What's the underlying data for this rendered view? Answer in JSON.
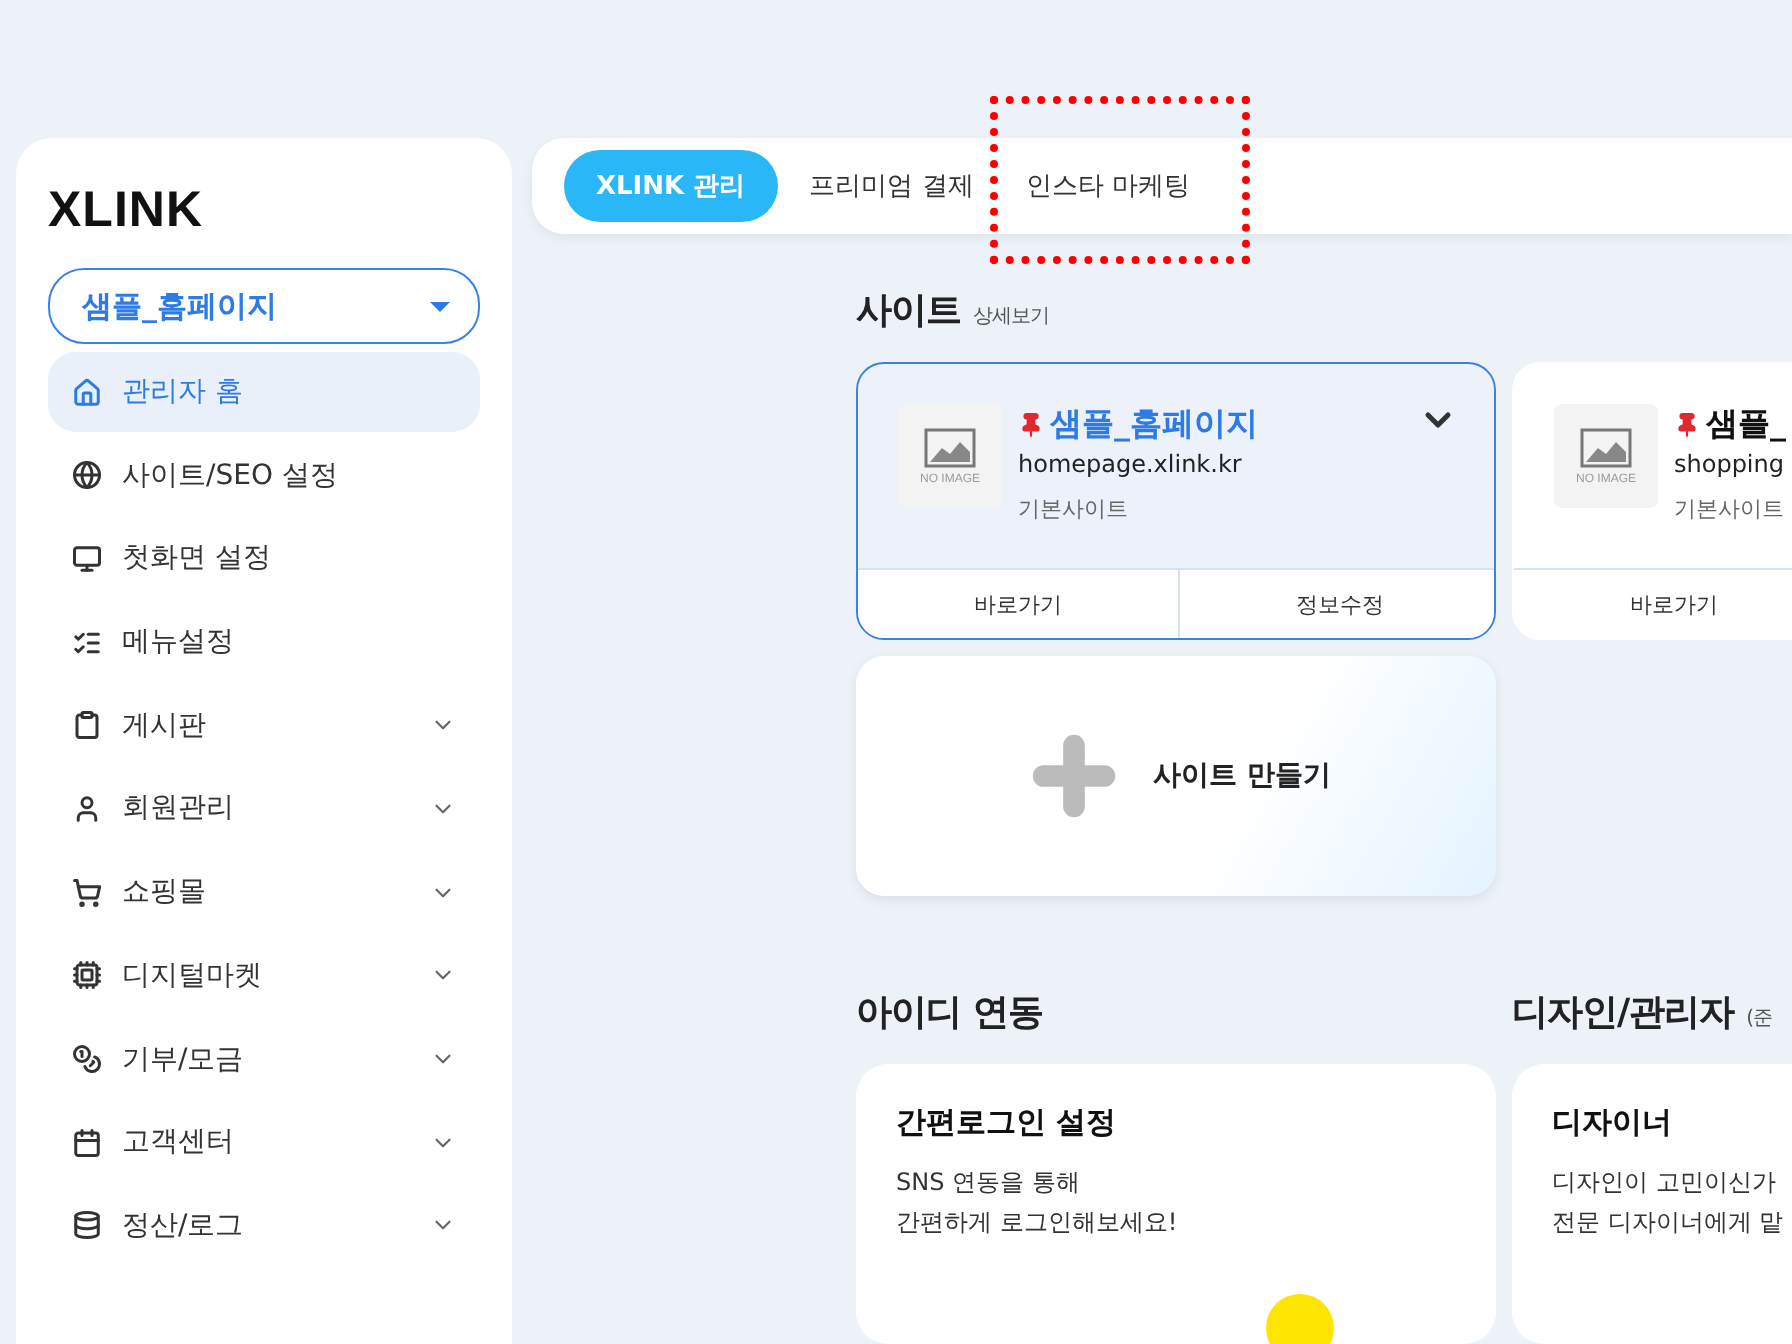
{
  "sidebar": {
    "logo": "XLINK",
    "site_select": {
      "value": "샘플_홈페이지"
    },
    "items": [
      {
        "label": "관리자 홈",
        "selected": true,
        "has_submenu": false
      },
      {
        "label": "사이트/SEO 설정",
        "selected": false,
        "has_submenu": false
      },
      {
        "label": "첫화면 설정",
        "selected": false,
        "has_submenu": false
      },
      {
        "label": "메뉴설정",
        "selected": false,
        "has_submenu": false
      },
      {
        "label": "게시판",
        "selected": false,
        "has_submenu": true
      },
      {
        "label": "회원관리",
        "selected": false,
        "has_submenu": true
      },
      {
        "label": "쇼핑몰",
        "selected": false,
        "has_submenu": true
      },
      {
        "label": "디지털마켓",
        "selected": false,
        "has_submenu": true
      },
      {
        "label": "기부/모금",
        "selected": false,
        "has_submenu": true
      },
      {
        "label": "고객센터",
        "selected": false,
        "has_submenu": true
      },
      {
        "label": "정산/로그",
        "selected": false,
        "has_submenu": true
      }
    ]
  },
  "top_tabs": [
    {
      "label": "XLINK 관리",
      "selected": true,
      "highlighted": false
    },
    {
      "label": "프리미엄 결제",
      "selected": false,
      "highlighted": false
    },
    {
      "label": "인스타 마케팅",
      "selected": false,
      "highlighted": true
    }
  ],
  "sites_section": {
    "title": "사이트",
    "link": "상세보기",
    "sites": [
      {
        "image_label": "NO IMAGE",
        "name": "샘플_홈페이지",
        "domain": "homepage.xlink.kr",
        "type": "기본사이트",
        "selected": true,
        "buttons": [
          "바로가기",
          "정보수정"
        ]
      },
      {
        "image_label": "NO IMAGE",
        "name": "샘플_",
        "domain": "shopping",
        "type": "기본사이트",
        "selected": false,
        "buttons": [
          "바로가기"
        ]
      }
    ],
    "create_label": "사이트 만들기"
  },
  "sections": [
    {
      "title": "아이디 연동",
      "card_title": "간편로그인 설정",
      "lines": [
        "SNS 연동을 통해",
        "간편하게 로그인해보세요!"
      ]
    },
    {
      "title": "디자인/관리자",
      "note": "(준",
      "card_title": "디자이너",
      "lines": [
        "디자인이 고민이신가",
        "전문 디자이너에게 맡"
      ]
    }
  ]
}
